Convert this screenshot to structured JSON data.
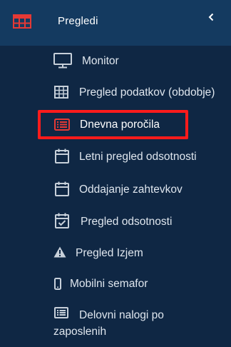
{
  "header": {
    "title": "Pregledi"
  },
  "menu": {
    "items": [
      {
        "label": "Monitor",
        "icon": "monitor-icon"
      },
      {
        "label": "Pregled podatkov (obdobje)",
        "icon": "table-grid-icon"
      },
      {
        "label": "Dnevna poročila",
        "icon": "report-list-icon",
        "active": true
      },
      {
        "label": "Letni pregled odsotnosti",
        "icon": "calendar-icon"
      },
      {
        "label": "Oddajanje zahtevkov",
        "icon": "calendar-icon"
      },
      {
        "label": "Pregled odsotnosti",
        "icon": "calendar-check-icon"
      },
      {
        "label": "Pregled Izjem",
        "icon": "warning-icon"
      },
      {
        "label": "Mobilni semafor",
        "icon": "mobile-phone-icon"
      },
      {
        "label_line1": "Delovni nalogi po",
        "label_line2": "zaposlenih",
        "icon": "list-alt-icon"
      }
    ]
  },
  "colors": {
    "background": "#0f2744",
    "header_background": "#143a60",
    "accent_red": "#e53935",
    "highlight_border": "#ff1b1b",
    "text": "#dfe6ee"
  }
}
